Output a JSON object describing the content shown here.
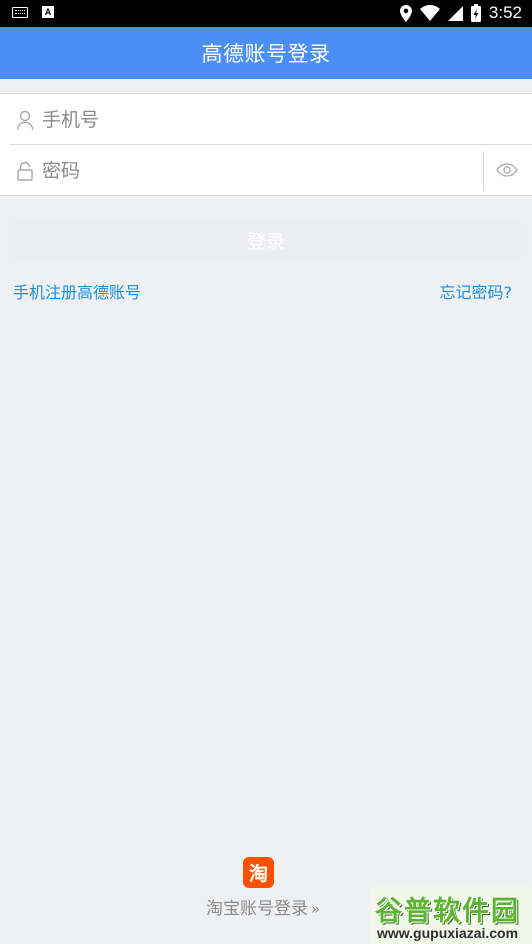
{
  "status_bar": {
    "time": "3:52",
    "a_icon_letter": "A"
  },
  "header": {
    "title": "高德账号登录"
  },
  "form": {
    "phone_placeholder": "手机号",
    "password_placeholder": "密码"
  },
  "actions": {
    "login_label": "登录",
    "register_link": "手机注册高德账号",
    "forgot_link": "忘记密码?"
  },
  "taobao": {
    "logo_char": "淘",
    "label": "淘宝账号登录",
    "chevron": "»"
  },
  "watermark": {
    "title": "谷普软件园",
    "url": "www.gupuxiazai.com"
  },
  "colors": {
    "header": "#4a8ef8",
    "link": "#1b8fe0",
    "taobao": "#ff5000"
  }
}
